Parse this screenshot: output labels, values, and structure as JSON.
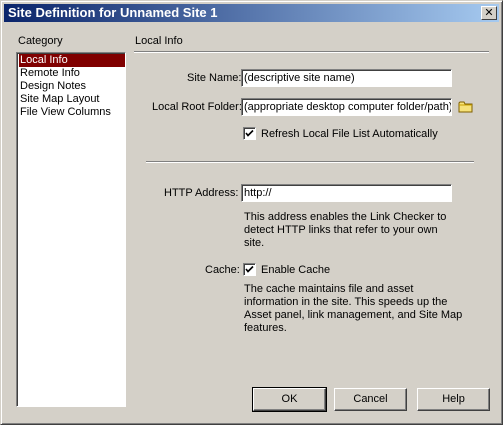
{
  "window": {
    "title": "Site Definition for Unnamed Site 1",
    "close_glyph": "✕"
  },
  "category": {
    "heading": "Category",
    "items": [
      {
        "label": "Local Info",
        "selected": true
      },
      {
        "label": "Remote Info"
      },
      {
        "label": "Design Notes"
      },
      {
        "label": "Site Map Layout"
      },
      {
        "label": "File View Columns"
      }
    ]
  },
  "panel": {
    "heading": "Local Info",
    "site_name": {
      "label": "Site Name:",
      "value": "(descriptive site name)"
    },
    "local_root": {
      "label": "Local Root Folder:",
      "value": "(appropriate desktop computer folder/path)",
      "browse_icon": "folder-icon"
    },
    "refresh": {
      "label": "Refresh Local File List Automatically",
      "checked": true
    },
    "http": {
      "label": "HTTP Address:",
      "value": "http://",
      "description": [
        "This address enables the Link Checker to",
        "detect HTTP links that refer to your own",
        "site."
      ]
    },
    "cache": {
      "label": "Cache:",
      "checkbox_label": "Enable Cache",
      "checked": true,
      "description": [
        "The cache maintains file and asset",
        "information in the site.  This speeds up the",
        "Asset panel, link management, and Site Map",
        "features."
      ]
    }
  },
  "buttons": {
    "ok": "OK",
    "cancel": "Cancel",
    "help": "Help"
  },
  "colors": {
    "selection": "#800000",
    "dialog_bg": "#d4d0c8",
    "title_start": "#0a246a",
    "title_end": "#a6caf0",
    "folder": "#f6e27a"
  }
}
